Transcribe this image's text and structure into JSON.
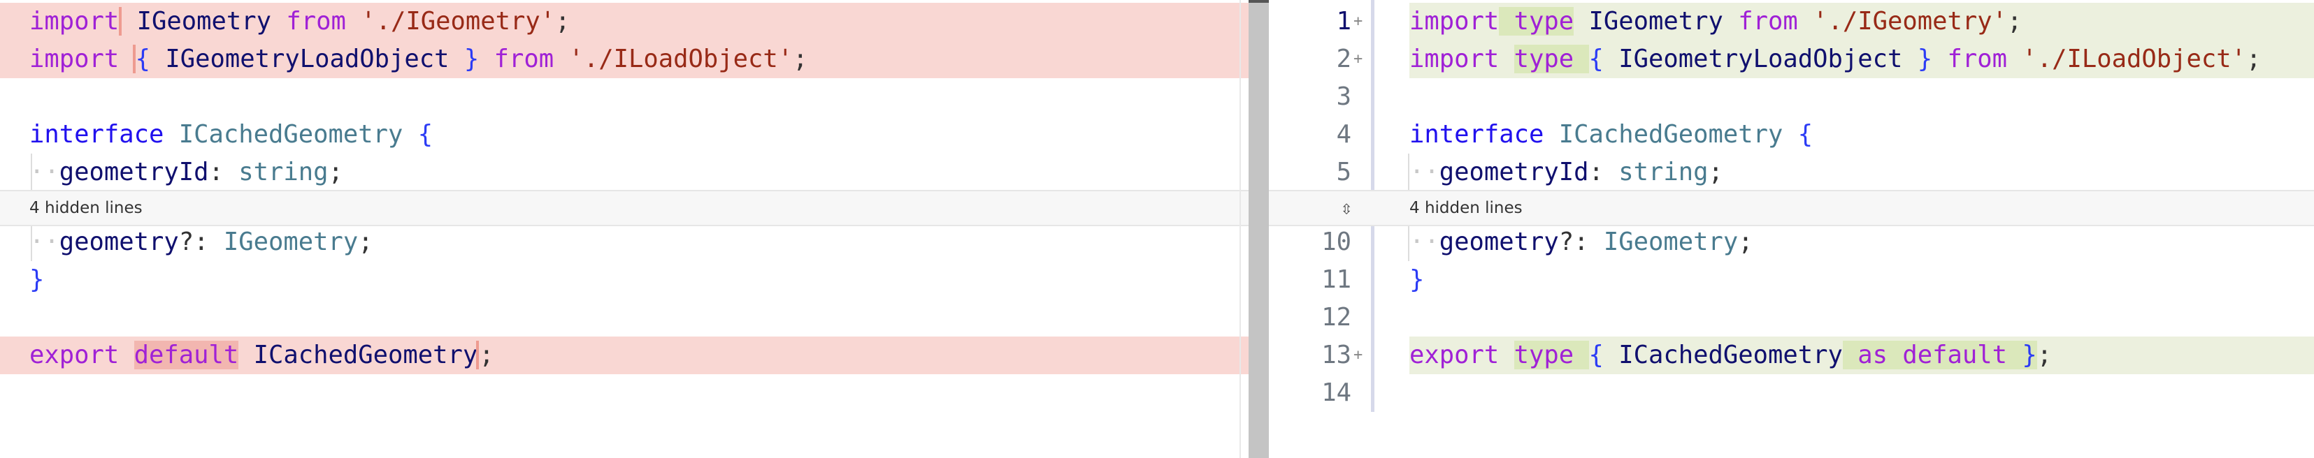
{
  "colors": {
    "deleted_bg": "#f9d7d3",
    "deleted_highlight": "#f2b6b0",
    "added_bg": "#ecf0de",
    "added_highlight": "#dbe8bb",
    "keyword": "#a021d6",
    "string": "#982a17",
    "type": "#497b8f"
  },
  "hidden": {
    "label": "4 hidden lines",
    "icon": "expand-vertical-icon"
  },
  "left": {
    "lines": [
      {
        "kind": "del",
        "tokens": [
          {
            "t": "import",
            "c": "kw",
            "m": "mark-after"
          },
          {
            "t": " IGeometry ",
            "c": "id"
          },
          {
            "t": "from",
            "c": "kw"
          },
          {
            "t": " './IGeometry'",
            "c": "str"
          },
          {
            "t": ";",
            "c": "pn"
          }
        ]
      },
      {
        "kind": "del",
        "tokens": [
          {
            "t": "import ",
            "c": "kw"
          },
          {
            "t": "{",
            "c": "br",
            "m": "mark-del"
          },
          {
            "t": " IGeometryLoadObject ",
            "c": "id"
          },
          {
            "t": "}",
            "c": "br"
          },
          {
            "t": " from",
            "c": "kw"
          },
          {
            "t": " './ILoadObject'",
            "c": "str"
          },
          {
            "t": ";",
            "c": "pn"
          }
        ]
      },
      {
        "kind": "ctx",
        "tokens": []
      },
      {
        "kind": "ctx",
        "tokens": [
          {
            "t": "interface",
            "c": "decl"
          },
          {
            "t": " ICachedGeometry",
            "c": "ty"
          },
          {
            "t": " {",
            "c": "br"
          }
        ]
      },
      {
        "kind": "ctx",
        "guide": true,
        "tokens": [
          {
            "t": "··",
            "c": "ws"
          },
          {
            "t": "geometryId",
            "c": "id"
          },
          {
            "t": ": ",
            "c": "pn"
          },
          {
            "t": "string",
            "c": "ty"
          },
          {
            "t": ";",
            "c": "pn"
          }
        ]
      },
      {
        "kind": "ctx",
        "guide": true,
        "tokens": [
          {
            "t": "··",
            "c": "ws"
          },
          {
            "t": "geometry",
            "c": "id"
          },
          {
            "t": "?: ",
            "c": "pn"
          },
          {
            "t": "IGeometry",
            "c": "ty"
          },
          {
            "t": ";",
            "c": "pn"
          }
        ]
      },
      {
        "kind": "ctx",
        "tokens": [
          {
            "t": "}",
            "c": "br"
          }
        ]
      },
      {
        "kind": "ctx",
        "tokens": []
      },
      {
        "kind": "del",
        "tokens": [
          {
            "t": "export ",
            "c": "kw"
          },
          {
            "t": "default",
            "c": "kw",
            "h": true
          },
          {
            "t": " ICachedGeometry",
            "c": "id"
          },
          {
            "t": ";",
            "c": "pn",
            "m": "mark-del"
          }
        ]
      }
    ]
  },
  "right": {
    "lines": [
      {
        "num": "1",
        "kind": "add",
        "plus": "+",
        "tokens": [
          {
            "t": "import",
            "c": "kw"
          },
          {
            "t": " type",
            "c": "kw",
            "h": true
          },
          {
            "t": " IGeometry ",
            "c": "id"
          },
          {
            "t": "from",
            "c": "kw"
          },
          {
            "t": " './IGeometry'",
            "c": "str"
          },
          {
            "t": ";",
            "c": "pn"
          }
        ]
      },
      {
        "num": "2",
        "kind": "add",
        "plus": "+",
        "tokens": [
          {
            "t": "import ",
            "c": "kw"
          },
          {
            "t": "type ",
            "c": "kw",
            "h": true
          },
          {
            "t": "{",
            "c": "br"
          },
          {
            "t": " IGeometryLoadObject ",
            "c": "id"
          },
          {
            "t": "}",
            "c": "br"
          },
          {
            "t": " from",
            "c": "kw"
          },
          {
            "t": " './ILoadObject'",
            "c": "str"
          },
          {
            "t": ";",
            "c": "pn"
          }
        ]
      },
      {
        "num": "3",
        "kind": "ctx",
        "tokens": []
      },
      {
        "num": "4",
        "kind": "ctx",
        "tokens": [
          {
            "t": "interface",
            "c": "decl"
          },
          {
            "t": " ICachedGeometry",
            "c": "ty"
          },
          {
            "t": " {",
            "c": "br"
          }
        ]
      },
      {
        "num": "5",
        "kind": "ctx",
        "guide": true,
        "tokens": [
          {
            "t": "··",
            "c": "ws"
          },
          {
            "t": "geometryId",
            "c": "id"
          },
          {
            "t": ": ",
            "c": "pn"
          },
          {
            "t": "string",
            "c": "ty"
          },
          {
            "t": ";",
            "c": "pn"
          }
        ]
      },
      {
        "num": "10",
        "kind": "ctx",
        "guide": true,
        "tokens": [
          {
            "t": "··",
            "c": "ws"
          },
          {
            "t": "geometry",
            "c": "id"
          },
          {
            "t": "?: ",
            "c": "pn"
          },
          {
            "t": "IGeometry",
            "c": "ty"
          },
          {
            "t": ";",
            "c": "pn"
          }
        ]
      },
      {
        "num": "11",
        "kind": "ctx",
        "tokens": [
          {
            "t": "}",
            "c": "br"
          }
        ]
      },
      {
        "num": "12",
        "kind": "ctx",
        "tokens": []
      },
      {
        "num": "13",
        "kind": "add",
        "plus": "+",
        "tokens": [
          {
            "t": "export ",
            "c": "kw"
          },
          {
            "t": "type ",
            "c": "kw",
            "h": true
          },
          {
            "t": "{",
            "c": "br"
          },
          {
            "t": " ICachedGeometry",
            "c": "id"
          },
          {
            "t": " as default ",
            "c": "kw",
            "h": true
          },
          {
            "t": "}",
            "c": "br",
            "h": true
          },
          {
            "t": ";",
            "c": "pn"
          }
        ]
      },
      {
        "num": "14",
        "kind": "ctx",
        "tokens": []
      }
    ]
  }
}
